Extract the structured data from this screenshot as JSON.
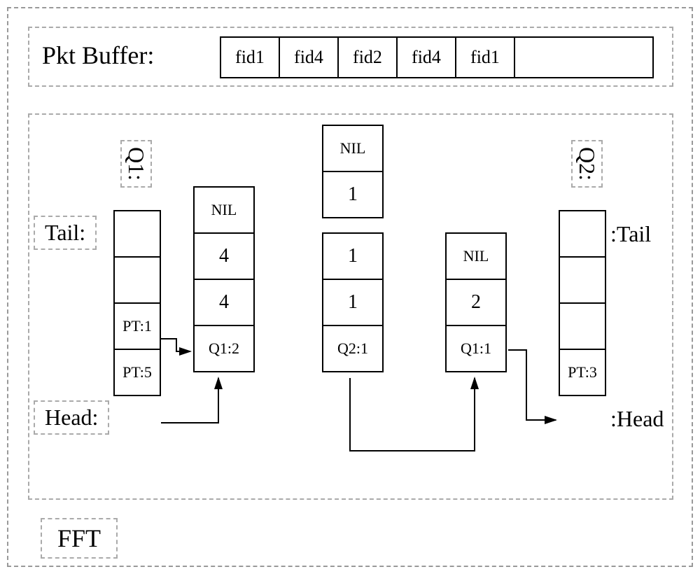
{
  "pkt_buffer": {
    "label": "Pkt Buffer:",
    "cells": [
      "fid1",
      "fid4",
      "fid2",
      "fid4",
      "fid1",
      ""
    ]
  },
  "labels": {
    "q1_top": "Q1:",
    "q2_top": "Q2:",
    "tail_left": "Tail:",
    "head_left": "Head:",
    "tail_right": ":Tail",
    "head_right": ":Head"
  },
  "stacks": {
    "left_main": [
      "",
      "",
      "PT:1",
      "PT:5"
    ],
    "col_a": [
      "NIL",
      "4",
      "4",
      "Q1:2"
    ],
    "col_b_ext": [
      "NIL",
      "1"
    ],
    "col_b": [
      "1",
      "1",
      "Q2:1"
    ],
    "col_c": [
      "NIL",
      "2",
      "Q1:1"
    ],
    "right_main": [
      "",
      "",
      "",
      "PT:3"
    ]
  },
  "footer": "FFT",
  "chart_data": {
    "type": "table",
    "title": "Packet buffer and queue pointer diagram",
    "pkt_buffer": [
      "fid1",
      "fid4",
      "fid2",
      "fid4",
      "fid1",
      ""
    ],
    "queues": {
      "Q1": {
        "head": "PT:5",
        "tail_ptr": "PT:1"
      },
      "Q2": {
        "head": "PT:3",
        "tail_ptr": ""
      }
    },
    "columns": [
      {
        "label": "Q1:2",
        "values": [
          4,
          4
        ],
        "terminator": "NIL"
      },
      {
        "label": "Q2:1",
        "values": [
          1,
          1,
          1
        ],
        "terminator": "NIL"
      },
      {
        "label": "Q1:1",
        "values": [
          2
        ],
        "terminator": "NIL"
      }
    ],
    "pointer_edges": [
      {
        "from": "Q1.head(PT:5)",
        "to": "Q1:2"
      },
      {
        "from": "Q1.PT:1",
        "to": "Q1:2"
      },
      {
        "from": "Q2:1",
        "to": "Q1:1"
      },
      {
        "from": "Q1:1",
        "to": "Q2.head(PT:3)"
      }
    ],
    "footer_block": "FFT"
  }
}
